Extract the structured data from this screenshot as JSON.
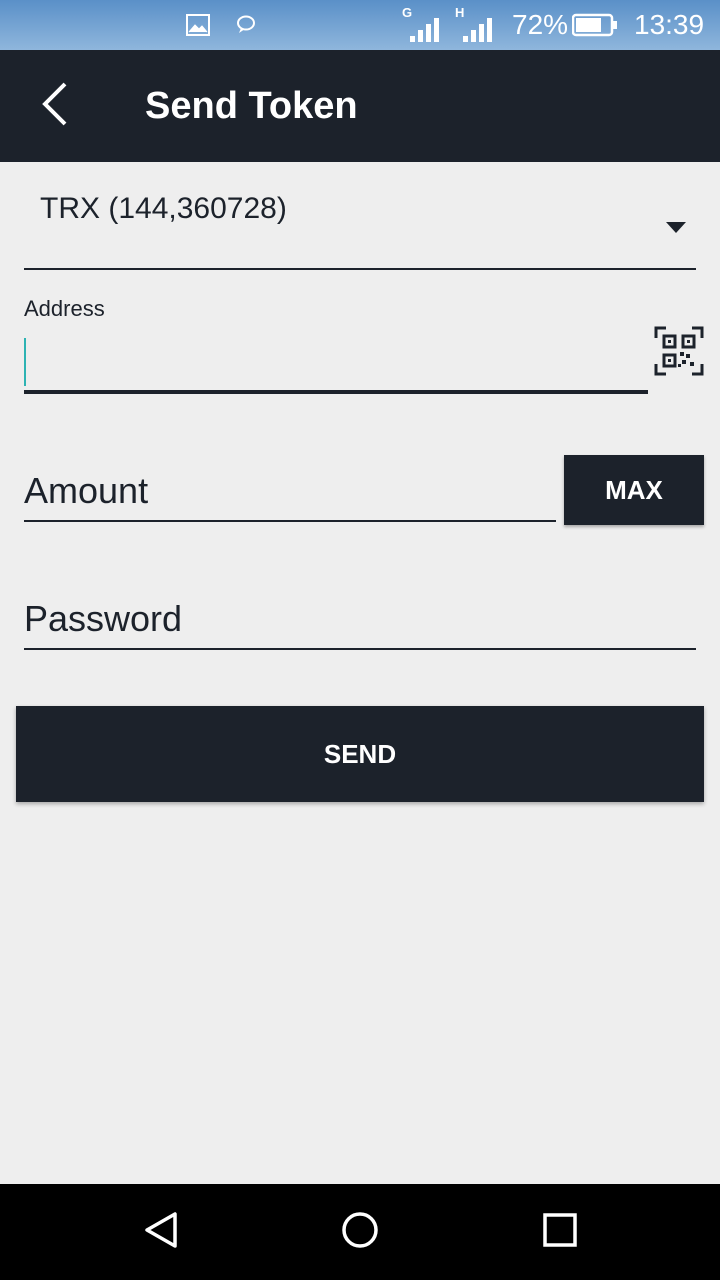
{
  "status_bar": {
    "icons": [
      "image-icon",
      "chat-icon",
      "signal-g-icon",
      "signal-h-icon",
      "battery-icon"
    ],
    "network_g": "G",
    "network_h": "H",
    "battery": "72%",
    "time": "13:39"
  },
  "header": {
    "title": "Send Token",
    "back_icon": "chevron-left-icon"
  },
  "form": {
    "token_selected": "TRX (144,360728)",
    "address_label": "Address",
    "address_value": "",
    "qr_icon": "qr-scan-icon",
    "amount_placeholder": "Amount",
    "max_label": "MAX",
    "password_placeholder": "Password",
    "send_label": "SEND"
  },
  "colors": {
    "primary": "#1c222b",
    "background": "#eeeeee",
    "cursor": "#2db3b3"
  },
  "nav_bar": {
    "icons": [
      "back-triangle-icon",
      "home-circle-icon",
      "recents-square-icon"
    ]
  }
}
